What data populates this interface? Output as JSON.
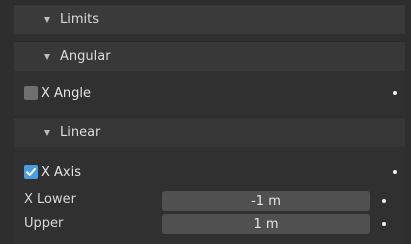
{
  "sections": {
    "limits": {
      "label": "Limits"
    },
    "angular": {
      "label": "Angular",
      "x_angle": {
        "label": "X Angle",
        "checked": false
      }
    },
    "linear": {
      "label": "Linear",
      "x_axis": {
        "label": "X Axis",
        "checked": true
      },
      "x_lower": {
        "label": "X Lower",
        "value": "-1 m"
      },
      "upper": {
        "label": "Upper",
        "value": "1 m"
      }
    }
  },
  "colors": {
    "checkbox_checked": "#4a9de0",
    "field_bg": "#505050"
  }
}
